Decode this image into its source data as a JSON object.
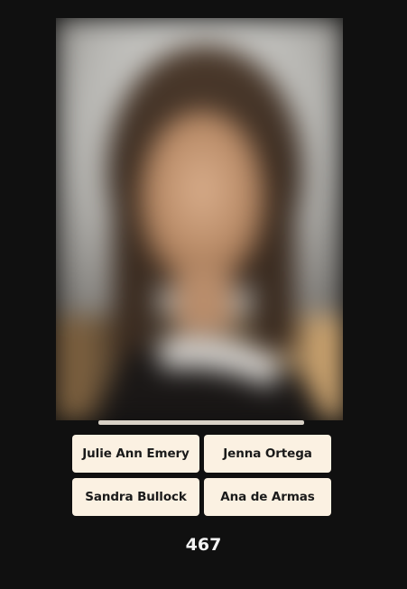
{
  "game": {
    "options": [
      "Julie Ann Emery",
      "Jenna Ortega",
      "Sandra Bullock",
      "Ana de Armas"
    ],
    "score": "467",
    "timer_progress": 1.0
  },
  "colors": {
    "background": "#101010",
    "button_bg": "#fbf1e2",
    "button_text": "#1a1a1a",
    "progress_fill": "#d8d1c6",
    "score_text": "#f2f2f2"
  }
}
